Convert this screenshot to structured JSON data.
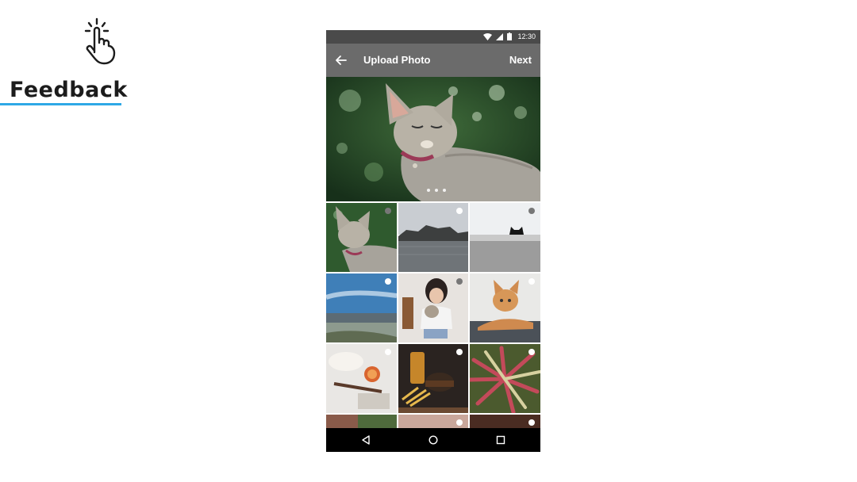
{
  "logo": {
    "text": "Feedback",
    "underline_color": "#2ea8e6",
    "icon": "tap-hand-icon"
  },
  "status_bar": {
    "time": "12:30",
    "icons": [
      "wifi-icon",
      "signal-icon",
      "battery-icon"
    ]
  },
  "app_bar": {
    "back_icon": "arrow-left-icon",
    "title": "Upload Photo",
    "action": "Next"
  },
  "hero": {
    "subject": "cat",
    "page_indicator": {
      "count": 3
    }
  },
  "gallery": {
    "photos": [
      {
        "subject": "cat",
        "selected": false
      },
      {
        "subject": "lake",
        "selected": false
      },
      {
        "subject": "black-cat-on-wall",
        "selected": false
      },
      {
        "subject": "coastal-city",
        "selected": false
      },
      {
        "subject": "girl-with-cat",
        "selected": false
      },
      {
        "subject": "ginger-cat",
        "selected": false
      },
      {
        "subject": "food-table",
        "selected": false
      },
      {
        "subject": "burger-and-fries",
        "selected": false
      },
      {
        "subject": "plant",
        "selected": false
      },
      {
        "subject": "portrait",
        "selected": false
      },
      {
        "subject": "food",
        "selected": false
      },
      {
        "subject": "dark-photo",
        "selected": false
      }
    ]
  },
  "nav_bar": {
    "buttons": [
      "back-triangle-icon",
      "home-circle-icon",
      "recents-square-icon"
    ]
  }
}
